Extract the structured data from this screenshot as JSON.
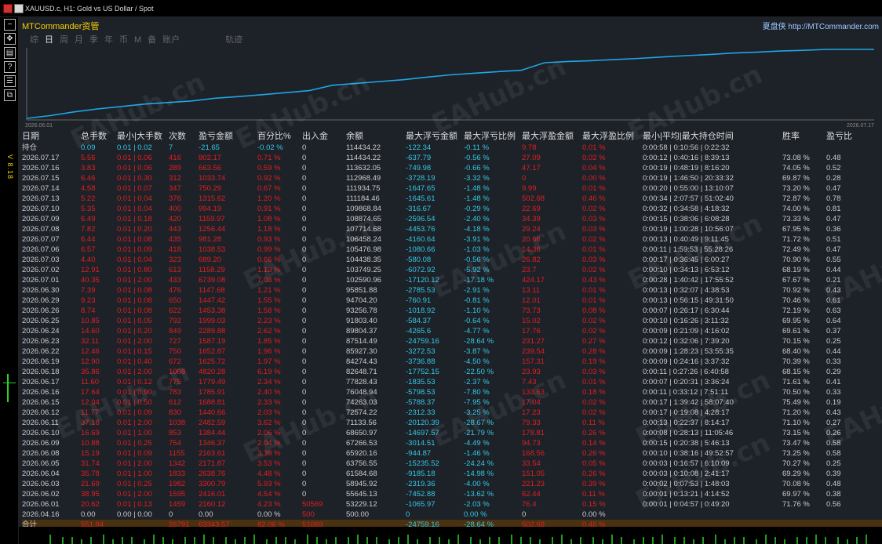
{
  "title": "XAUUSD.c, H1:  Gold vs US Dollar / Spot",
  "brand": "MTCommander资管",
  "header_right": "夏盘侠 http://MTCommander.com",
  "tabs": [
    "综",
    "日",
    "周",
    "月",
    "季",
    "年",
    "币",
    "M",
    "备",
    "账户",
    "轨迹"
  ],
  "active_tab": "日",
  "side_label": "V 8.18",
  "watermark": "EAHub.cn",
  "chart_data": {
    "type": "line",
    "x": [
      "2026.06.01",
      "2026.06.02",
      "2026.06.03",
      "2026.06.04",
      "2026.06.05",
      "2026.06.06",
      "2026.06.08",
      "2026.06.09",
      "2026.06.10",
      "2026.06.11",
      "2026.06.12",
      "2026.06.13",
      "2026.06.15",
      "2026.06.16",
      "2026.06.17",
      "2026.06.18",
      "2026.06.19",
      "2026.06.22",
      "2026.06.23",
      "2026.06.24",
      "2026.06.25",
      "2026.06.26",
      "2026.06.29",
      "2026.06.30",
      "2026.07.01",
      "2026.07.02",
      "2026.07.03",
      "2026.07.06",
      "2026.07.07",
      "2026.07.08",
      "2026.07.09",
      "2026.07.10",
      "2026.07.13",
      "2026.07.14",
      "2026.07.15",
      "2026.07.16",
      "2026.07.17"
    ],
    "values": [
      53229.12,
      55645.13,
      58945.92,
      61584.68,
      63756.55,
      65920.16,
      67266.53,
      68650.97,
      71133.56,
      72574.22,
      74263.03,
      76048.94,
      77828.43,
      82648.71,
      84274.43,
      85927.3,
      87514.49,
      89804.37,
      91803.4,
      93256.78,
      94704.2,
      95851.88,
      102590.96,
      103749.25,
      104438.35,
      105476.98,
      106458.24,
      107714.68,
      108874.65,
      109868.84,
      111184.46,
      111934.75,
      112968.49,
      113632.05,
      114434.22,
      114434.22,
      114434.22
    ],
    "x_start_label": "2026.06.01",
    "x_end_label": "2026.07.17",
    "line_color": "#1ea7e6"
  },
  "columns": [
    "日期",
    "总手数",
    "最小|大手数",
    "次数",
    "盈亏金额",
    "百分比%",
    "出入金",
    "余额",
    "最大浮亏金额",
    "最大浮亏比例",
    "最大浮盈金额",
    "最大浮盈比例",
    "最小|平均|最大持仓时间",
    "胜率",
    "盈亏比"
  ],
  "position_row": {
    "label": "持仓",
    "lots": "0.09",
    "minmax": "0.01 | 0.02",
    "count": "7",
    "pnl": "-21.65",
    "pct": "-0.02 %",
    "io": "0",
    "balance": "114434.22",
    "mfl": "-122.34",
    "mflp": "-0.11 %",
    "mfp": "9.78",
    "mfpp": "0.01 %",
    "time": "0:00:58 | 0:10:56 | 0:22:32",
    "win": "",
    "ratio": ""
  },
  "rows": [
    [
      "2026.07.17",
      "5.56",
      "0.01 | 0.06",
      "416",
      "802.17",
      "0.71 %",
      "0",
      "114434.22",
      "-637.79",
      "-0.56 %",
      "27.09",
      "0.02 %",
      "0:00:12 | 0:40:16 | 8:39:13",
      "73.08 %",
      "0.48"
    ],
    [
      "2026.07.16",
      "3.83",
      "0.01 | 0.06",
      "289",
      "663.56",
      "0.59 %",
      "0",
      "113632.05",
      "-749.98",
      "-0.66 %",
      "47.17",
      "0.04 %",
      "0:00:19 | 0:48:19 | 8:16:20",
      "74.05 %",
      "0.52"
    ],
    [
      "2026.07.15",
      "6.46",
      "0.01 | 0.30",
      "312",
      "1033.74",
      "0.92 %",
      "0",
      "112968.49",
      "-3728.19",
      "-3.32 %",
      "0",
      "0.00 %",
      "0:00:19 | 1:46:50 | 20:33:32",
      "69.87 %",
      "0.28"
    ],
    [
      "2026.07.14",
      "4.58",
      "0.01 | 0.07",
      "347",
      "750.29",
      "0.67 %",
      "0",
      "111934.75",
      "-1647.65",
      "-1.48 %",
      "9.99",
      "0.01 %",
      "0:00:20 | 0:55:00 | 13:10:07",
      "73.20 %",
      "0.47"
    ],
    [
      "2026.07.13",
      "5.22",
      "0.01 | 0.04",
      "376",
      "1315.62",
      "1.20 %",
      "0",
      "111184.46",
      "-1645.61",
      "-1.48 %",
      "502.68",
      "0.46 %",
      "0:00:34 | 2:07:57 | 51:02:40",
      "72.87 %",
      "0.78"
    ],
    [
      "2026.07.10",
      "5.35",
      "0.01 | 0.04",
      "400",
      "994.19",
      "0.91 %",
      "0",
      "109868.84",
      "-316.67",
      "-0.29 %",
      "22.69",
      "0.02 %",
      "0:00:32 | 0:34:58 | 4:18:32",
      "74.00 %",
      "0.81"
    ],
    [
      "2026.07.09",
      "6.49",
      "0.01 | 0.18",
      "420",
      "1159.97",
      "1.08 %",
      "0",
      "108874.65",
      "-2596.54",
      "-2.40 %",
      "34.39",
      "0.03 %",
      "0:00:15 | 0:38:06 | 6:08:28",
      "73.33 %",
      "0.47"
    ],
    [
      "2026.07.08",
      "7.82",
      "0.01 | 0.20",
      "443",
      "1256.44",
      "1.18 %",
      "0",
      "107714.68",
      "-4453.76",
      "-4.18 %",
      "29.24",
      "0.03 %",
      "0:00:19 | 1:00:28 | 10:56:07",
      "67.95 %",
      "0.36"
    ],
    [
      "2026.07.07",
      "6.44",
      "0.01 | 0.08",
      "435",
      "981.28",
      "0.93 %",
      "0",
      "106458.24",
      "-4160.64",
      "-3.91 %",
      "20.66",
      "0.02 %",
      "0:00:13 | 0:40:49 | 9:11:45",
      "71.72 %",
      "0.51"
    ],
    [
      "2026.07.06",
      "6.57",
      "0.01 | 0.09",
      "418",
      "1038.53",
      "0.99 %",
      "0",
      "105476.98",
      "-1080.66",
      "-1.03 %",
      "14.36",
      "0.01 %",
      "0:00:11 | 1:59:53 | 55:28:26",
      "72.49 %",
      "0.47"
    ],
    [
      "2026.07.03",
      "4.40",
      "0.01 | 0.04",
      "323",
      "689.20",
      "0.66 %",
      "0",
      "104438.35",
      "-580.08",
      "-0.56 %",
      "26.82",
      "0.03 %",
      "0:00:17 | 0:36:45 | 6:00:27",
      "70.90 %",
      "0.55"
    ],
    [
      "2026.07.02",
      "12.91",
      "0.01 | 0.80",
      "613",
      "1158.29",
      "1.13 %",
      "0",
      "103749.25",
      "-6072.92",
      "-5.92 %",
      "23.7",
      "0.02 %",
      "0:00:10 | 0:34:13 | 6:53:12",
      "68.19 %",
      "0.44"
    ],
    [
      "2026.07.01",
      "40.35",
      "0.01 | 2.00",
      "433",
      "6739.08",
      "7.03 %",
      "0",
      "102590.96",
      "-17120.12",
      "-17.18 %",
      "424.17",
      "0.43 %",
      "0:00:28 | 1:40:42 | 17:55:52",
      "67.67 %",
      "0.21"
    ],
    [
      "2026.06.30",
      "7.39",
      "0.01 | 0.08",
      "476",
      "1147.68",
      "1.21 %",
      "0",
      "95851.88",
      "-2785.53",
      "-2.91 %",
      "13.11",
      "0.01 %",
      "0:00:13 | 0:32:07 | 4:38:53",
      "70.92 %",
      "0.43"
    ],
    [
      "2026.06.29",
      "9.23",
      "0.01 | 0.08",
      "650",
      "1447.42",
      "1.55 %",
      "0",
      "94704.20",
      "-760.91",
      "-0.81 %",
      "12.01",
      "0.01 %",
      "0:00:13 | 0:56:15 | 49:31:50",
      "70.46 %",
      "0.61"
    ],
    [
      "2026.06.26",
      "8.74",
      "0.01 | 0.08",
      "622",
      "1453.38",
      "1.58 %",
      "0",
      "93256.78",
      "-1018.92",
      "-1.10 %",
      "73.73",
      "0.08 %",
      "0:00:07 | 0:26:17 | 6:30:44",
      "72.19 %",
      "0.63"
    ],
    [
      "2026.06.25",
      "10.85",
      "0.01 | 0.05",
      "792",
      "1999.03",
      "2.23 %",
      "0",
      "91803.40",
      "-584.37",
      "-0.64 %",
      "15.02",
      "0.02 %",
      "0:00:10 | 0:16:26 | 3:11:32",
      "69.95 %",
      "0.64"
    ],
    [
      "2026.06.24",
      "14.60",
      "0.01 | 0.20",
      "849",
      "2289.88",
      "2.62 %",
      "0",
      "89804.37",
      "-4265.6",
      "-4.77 %",
      "17.76",
      "0.02 %",
      "0:00:09 | 0:21:09 | 4:16:02",
      "69.61 %",
      "0.37"
    ],
    [
      "2026.06.23",
      "32.11",
      "0.01 | 2.00",
      "727",
      "1587.19",
      "1.85 %",
      "0",
      "87514.49",
      "-24759.16",
      "-28.64 %",
      "231.27",
      "0.27 %",
      "0:00:12 | 0:32:06 | 7:39:20",
      "70.15 %",
      "0.25"
    ],
    [
      "2026.06.22",
      "12.46",
      "0.01 | 0.15",
      "750",
      "1652.87",
      "1.96 %",
      "0",
      "85927.30",
      "-3272.53",
      "-3.87 %",
      "239.54",
      "0.28 %",
      "0:00:09 | 1:28:23 | 53:55:35",
      "68.40 %",
      "0.44"
    ],
    [
      "2026.06.19",
      "12.90",
      "0.01 | 0.40",
      "672",
      "1625.72",
      "1.97 %",
      "0",
      "84274.43",
      "-3736.88",
      "-4.50 %",
      "157.31",
      "0.19 %",
      "0:00:09 | 0:24:16 | 3:37:32",
      "70.39 %",
      "0.33"
    ],
    [
      "2026.06.18",
      "35.86",
      "0.01 | 2.00",
      "1008",
      "4820.28",
      "6.19 %",
      "0",
      "82648.71",
      "-17752.15",
      "-22.50 %",
      "23.93",
      "0.03 %",
      "0:00:11 | 0:27:26 | 6:40:58",
      "68.15 %",
      "0.29"
    ],
    [
      "2026.06.17",
      "11.60",
      "0.01 | 0.12",
      "775",
      "1779.49",
      "2.34 %",
      "0",
      "77828.43",
      "-1835.53",
      "-2.37 %",
      "7.43",
      "0.01 %",
      "0:00:07 | 0:20:31 | 3:36:24",
      "71.61 %",
      "0.41"
    ],
    [
      "2026.06.16",
      "17.64",
      "0.01 | 0.90",
      "783",
      "1785.91",
      "2.40 %",
      "0",
      "76048.94",
      "-5798.53",
      "-7.80 %",
      "133.63",
      "0.18 %",
      "0:00:11 | 0:33:12 | 7:51:11",
      "70.50 %",
      "0.33"
    ],
    [
      "2026.06.15",
      "12.04",
      "0.01 | 0.50",
      "612",
      "1688.81",
      "2.33 %",
      "0",
      "74263.03",
      "-5788.37",
      "-7.95 %",
      "17.04",
      "0.02 %",
      "0:00:17 | 1:39:42 | 58:07:40",
      "75.49 %",
      "0.19"
    ],
    [
      "2026.06.12",
      "11.77",
      "0.01 | 0.09",
      "830",
      "1440.66",
      "2.03 %",
      "0",
      "72574.22",
      "-2312.33",
      "-3.25 %",
      "17.23",
      "0.02 %",
      "0:00:17 | 0:19:08 | 4:28:17",
      "71.20 %",
      "0.43"
    ],
    [
      "2026.06.11",
      "37.16",
      "0.01 | 2.00",
      "1038",
      "2482.59",
      "3.62 %",
      "0",
      "71133.56",
      "-20120.39",
      "-28.67 %",
      "79.33",
      "0.11 %",
      "0:00:13 | 0:22:37 | 8:14:17",
      "71.10 %",
      "0.27"
    ],
    [
      "2026.06.10",
      "16.69",
      "0.01 | 1.00",
      "853",
      "1384.44",
      "2.06 %",
      "0",
      "68650.97",
      "-14697.57",
      "-21.79 %",
      "178.81",
      "0.26 %",
      "0:00:08 | 0:28:13 | 11:05:46",
      "73.15 %",
      "0.26"
    ],
    [
      "2026.06.09",
      "10.88",
      "0.01 | 0.25",
      "754",
      "1346.37",
      "2.04 %",
      "0",
      "67266.53",
      "-3014.51",
      "-4.49 %",
      "94.73",
      "0.14 %",
      "0:00:15 | 0:20:38 | 5:46:13",
      "73.47 %",
      "0.58"
    ],
    [
      "2026.06.08",
      "15.19",
      "0.01 | 0.09",
      "1155",
      "2163.61",
      "3.39 %",
      "0",
      "65920.16",
      "-944.87",
      "-1.46 %",
      "168.56",
      "0.26 %",
      "0:00:10 | 0:38:16 | 49:52:57",
      "73.25 %",
      "0.58"
    ],
    [
      "2026.06.05",
      "31.74",
      "0.01 | 2.00",
      "1342",
      "2171.87",
      "3.53 %",
      "0",
      "63756.55",
      "-15235.52",
      "-24.24 %",
      "33.54",
      "0.05 %",
      "0:00:03 | 0:16:57 | 6:10:09",
      "70.27 %",
      "0.25"
    ],
    [
      "2026.06.04",
      "35.78",
      "0.01 | 1.00",
      "1833",
      "2638.76",
      "4.48 %",
      "0",
      "61584.68",
      "-9185.18",
      "-14.98 %",
      "151.05",
      "0.26 %",
      "0:00:03 | 0:10:08 | 2:41:17",
      "69.29 %",
      "0.39"
    ],
    [
      "2026.06.03",
      "21.69",
      "0.01 | 0.25",
      "1982",
      "3300.79",
      "5.93 %",
      "0",
      "58945.92",
      "-2319.36",
      "-4.00 %",
      "221.23",
      "0.39 %",
      "0:00:02 | 0:07:53 | 1:48:03",
      "70.08 %",
      "0.48"
    ],
    [
      "2026.06.02",
      "38.95",
      "0.01 | 2.00",
      "1595",
      "2416.01",
      "4.54 %",
      "0",
      "55645.13",
      "-7452.88",
      "-13.62 %",
      "62.44",
      "0.11 %",
      "0:00:01 | 0:13:21 | 4:14:52",
      "69.97 %",
      "0.38"
    ],
    [
      "2026.06.01",
      "20.62",
      "0.01 | 0.13",
      "1459",
      "2160.12",
      "4.23 %",
      "50569",
      "53229.12",
      "-1065.97",
      "-2.03 %",
      "76.4",
      "0.15 %",
      "0:00:01 | 0:04:57 | 0:49:20",
      "71.76 %",
      "0.56"
    ],
    [
      "2026.04.16",
      "0.00",
      "0.00 | 0.00",
      "0",
      "0.00",
      "0.00 %",
      "500",
      "500.00",
      "0",
      "0.00 %",
      "0",
      "0.00 %",
      "",
      "",
      ""
    ]
  ],
  "total_row": {
    "label": "合计",
    "lots": "551.94",
    "count": "26791",
    "pnl": "63343.57",
    "pct": "82.06 %",
    "io": "51069",
    "mfl": "-24759.16",
    "mflp": "-28.64 %",
    "mfp": "502.68",
    "mfpp": "0.46 %"
  }
}
